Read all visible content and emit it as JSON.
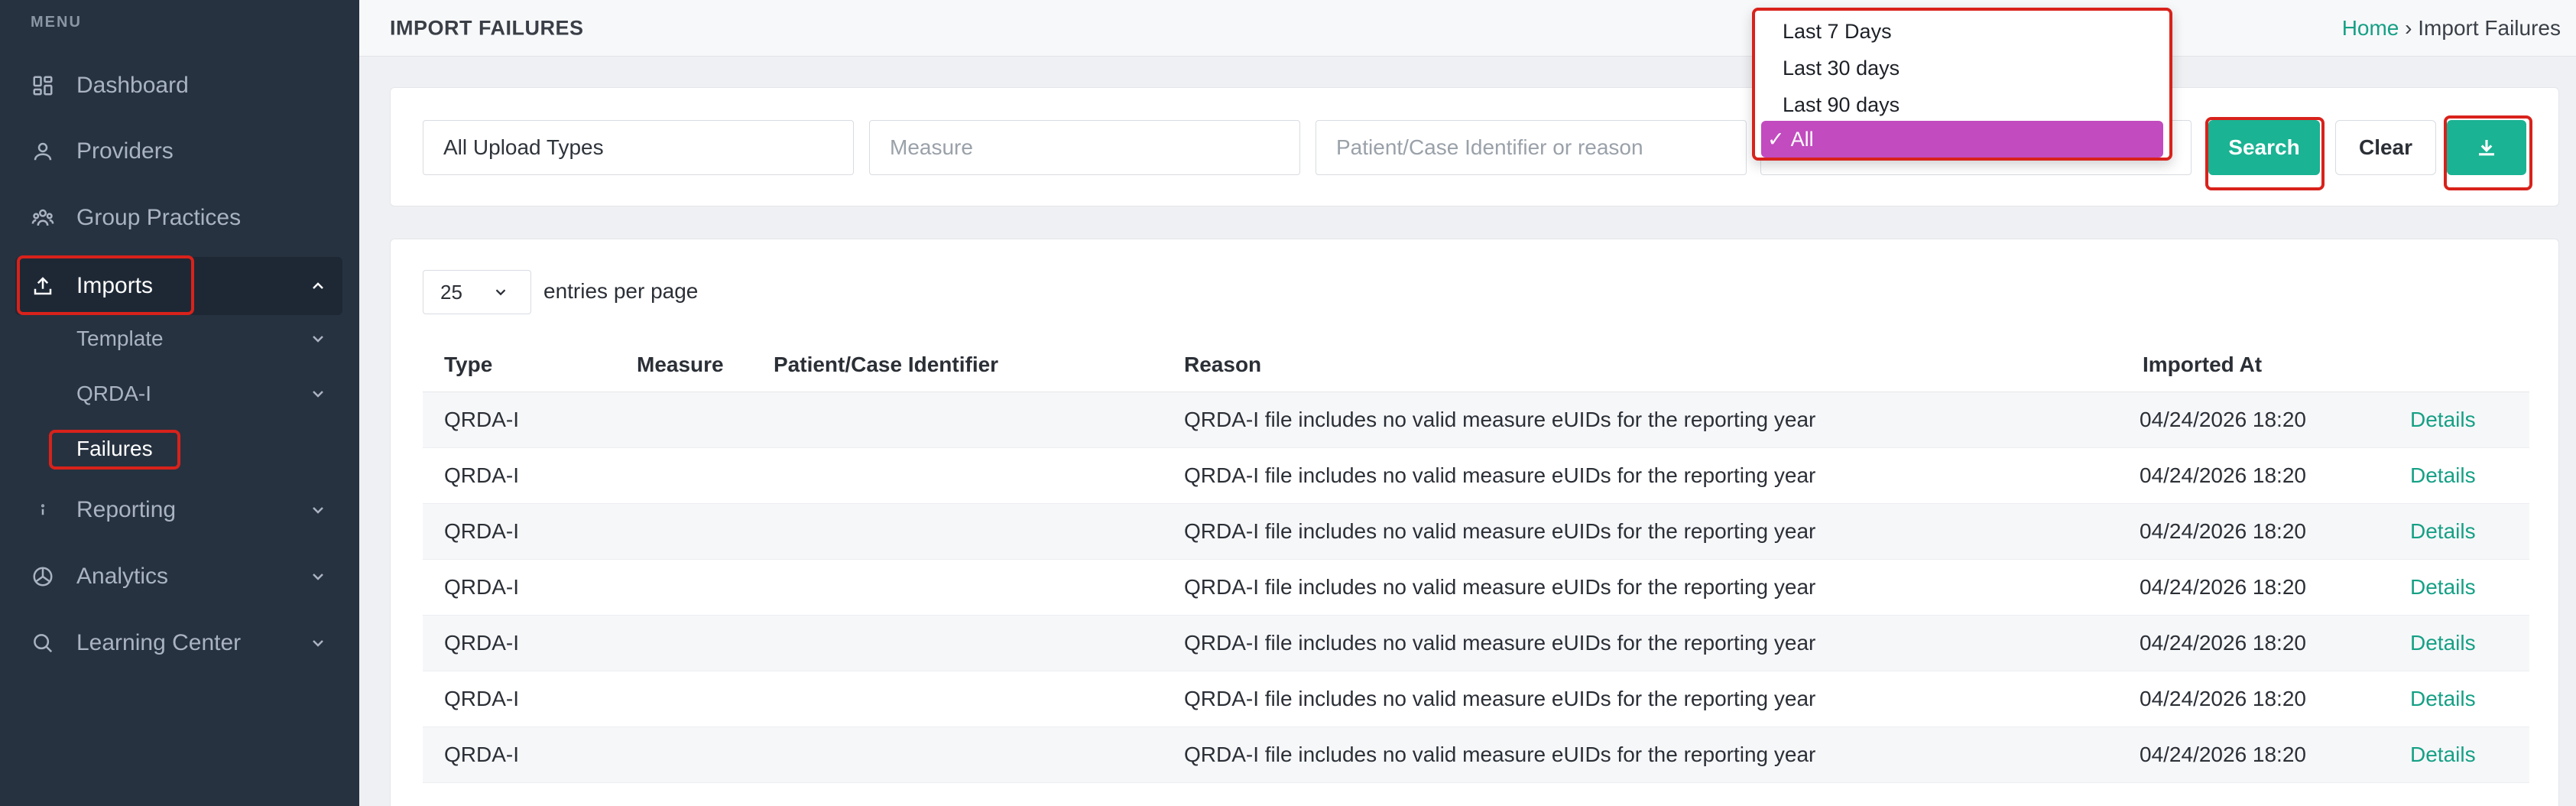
{
  "sidebar": {
    "menu_heading": "MENU",
    "items": [
      {
        "label": "Dashboard",
        "icon": "dashboard-icon"
      },
      {
        "label": "Providers",
        "icon": "user-icon"
      },
      {
        "label": "Group Practices",
        "icon": "group-icon"
      },
      {
        "label": "Imports",
        "icon": "upload-icon"
      },
      {
        "label": "Reporting",
        "icon": "info-icon"
      },
      {
        "label": "Analytics",
        "icon": "chart-pie-icon"
      },
      {
        "label": "Learning Center",
        "icon": "search-icon"
      }
    ],
    "imports_subitems": [
      {
        "label": "Template"
      },
      {
        "label": "QRDA-I"
      },
      {
        "label": "Failures"
      }
    ]
  },
  "header": {
    "title": "IMPORT FAILURES",
    "breadcrumb_home": "Home",
    "breadcrumb_separator": " › ",
    "breadcrumb_current": "Import Failures"
  },
  "filters": {
    "upload_type_value": "All Upload Types",
    "measure_placeholder": "Measure",
    "identifier_placeholder": "Patient/Case Identifier or reason",
    "search_label": "Search",
    "clear_label": "Clear"
  },
  "date_dropdown": {
    "options": [
      "Last 7 Days",
      "Last 30 days",
      "Last 90 days",
      "All"
    ],
    "selected": "All",
    "check_mark": "✓"
  },
  "table": {
    "per_page_value": "25",
    "per_page_label": "entries per page",
    "columns": [
      "Type",
      "Measure",
      "Patient/Case Identifier",
      "Reason",
      "Imported At"
    ],
    "rows": [
      {
        "type": "QRDA-I",
        "measure": "",
        "identifier": "",
        "reason": "QRDA-I file includes no valid measure eUIDs for the reporting year",
        "imported_at": "04/24/2026 18:20",
        "action": "Details"
      },
      {
        "type": "QRDA-I",
        "measure": "",
        "identifier": "",
        "reason": "QRDA-I file includes no valid measure eUIDs for the reporting year",
        "imported_at": "04/24/2026 18:20",
        "action": "Details"
      },
      {
        "type": "QRDA-I",
        "measure": "",
        "identifier": "",
        "reason": "QRDA-I file includes no valid measure eUIDs for the reporting year",
        "imported_at": "04/24/2026 18:20",
        "action": "Details"
      },
      {
        "type": "QRDA-I",
        "measure": "",
        "identifier": "",
        "reason": "QRDA-I file includes no valid measure eUIDs for the reporting year",
        "imported_at": "04/24/2026 18:20",
        "action": "Details"
      },
      {
        "type": "QRDA-I",
        "measure": "",
        "identifier": "",
        "reason": "QRDA-I file includes no valid measure eUIDs for the reporting year",
        "imported_at": "04/24/2026 18:20",
        "action": "Details"
      },
      {
        "type": "QRDA-I",
        "measure": "",
        "identifier": "",
        "reason": "QRDA-I file includes no valid measure eUIDs for the reporting year",
        "imported_at": "04/24/2026 18:20",
        "action": "Details"
      },
      {
        "type": "QRDA-I",
        "measure": "",
        "identifier": "",
        "reason": "QRDA-I file includes no valid measure eUIDs for the reporting year",
        "imported_at": "04/24/2026 18:20",
        "action": "Details"
      }
    ]
  },
  "colors": {
    "sidebar_bg": "#273240",
    "accent": "#1ab394",
    "link": "#16a085",
    "selected_option": "#c24bbf",
    "highlight": "#d8221b"
  }
}
